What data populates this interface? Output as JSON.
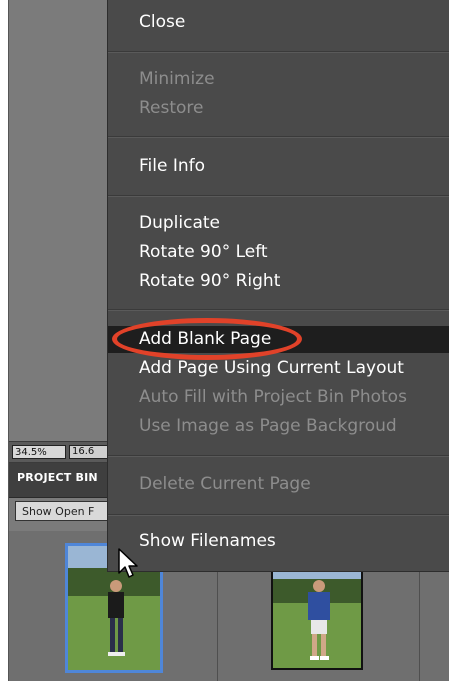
{
  "menu": {
    "items": [
      {
        "label": "Close",
        "enabled": true
      },
      {
        "label": "Minimize",
        "enabled": false
      },
      {
        "label": "Restore",
        "enabled": false
      },
      {
        "label": "File Info",
        "enabled": true
      },
      {
        "label": "Duplicate",
        "enabled": true
      },
      {
        "label": "Rotate 90° Left",
        "enabled": true
      },
      {
        "label": "Rotate 90° Right",
        "enabled": true
      },
      {
        "label": "Add Blank Page",
        "enabled": true,
        "highlighted": true
      },
      {
        "label": "Add Page Using Current Layout",
        "enabled": true
      },
      {
        "label": "Auto Fill with Project Bin Photos",
        "enabled": false
      },
      {
        "label": "Use Image as Page Backgroud",
        "enabled": false
      },
      {
        "label": "Delete Current Page",
        "enabled": false
      },
      {
        "label": "Show Filenames",
        "enabled": true
      }
    ]
  },
  "status": {
    "zoom": "34.5%",
    "zoom2": "16.6"
  },
  "project_bin": {
    "title": "PROJECT BIN",
    "show_button": "Show Open F"
  },
  "colors": {
    "annotation": "#e14229",
    "selected_thumb_border": "#4f86d8",
    "menu_bg": "#4a4a4a",
    "highlight_bg": "#1e1e1e"
  }
}
